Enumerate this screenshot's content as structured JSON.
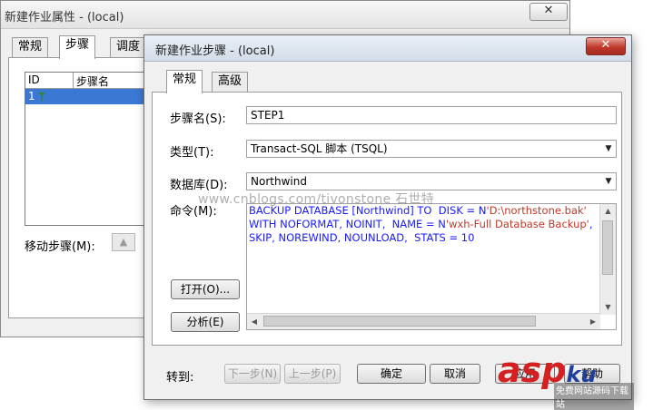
{
  "back_window": {
    "title": "新建作业属性 - (local)",
    "close": "✕",
    "tabs": [
      {
        "label": "常规"
      },
      {
        "label": "步骤"
      },
      {
        "label": "调度"
      }
    ],
    "list": {
      "columns": [
        "ID",
        "步骤名"
      ],
      "rows": [
        {
          "id": "1"
        }
      ]
    },
    "move_label": "移动步骤(M):",
    "move_up_icon": "up-arrow-icon"
  },
  "dialog": {
    "title": "新建作业步骤 - (local)",
    "close": "✕",
    "tabs": [
      {
        "label": "常规"
      },
      {
        "label": "高级"
      }
    ],
    "step_name": {
      "label": "步骤名(S):",
      "value": "STEP1"
    },
    "type": {
      "label": "类型(T):",
      "value": "Transact-SQL 脚本 (TSQL)"
    },
    "database": {
      "label": "数据库(D):",
      "value": "Northwind"
    },
    "command": {
      "label": "命令(M):",
      "line1": "BACKUP DATABASE [Northwind] TO  DISK = N",
      "line1_str": "'D:\\northstone.bak'",
      "line2": "WITH NOFORMAT, NOINIT,  NAME = N",
      "line2_str": "'wxh-Full Database Backup'",
      "line2_end": ",",
      "line3": "SKIP, NOREWIND, NOUNLOAD,  STATS = 10"
    },
    "open_button": "打开(O)...",
    "parse_button": "分析(E)",
    "goto_label": "转到:",
    "next_button": "下一步(N)",
    "prev_button": "上一步(P)",
    "ok_button": "确定",
    "cancel_button": "取消",
    "apply_button": "应用",
    "help_button": "帮助"
  },
  "watermark": "www.cnblogs.com/tivonstone 石世特",
  "logo": {
    "text": "asp",
    "ku": "ku",
    "sub": "免费网站源码下载站"
  },
  "colors": {
    "selection": "#3a78d4",
    "sql_keyword": "#1a1aff",
    "sql_string": "#c0392b",
    "logo_red": "#d42020"
  }
}
